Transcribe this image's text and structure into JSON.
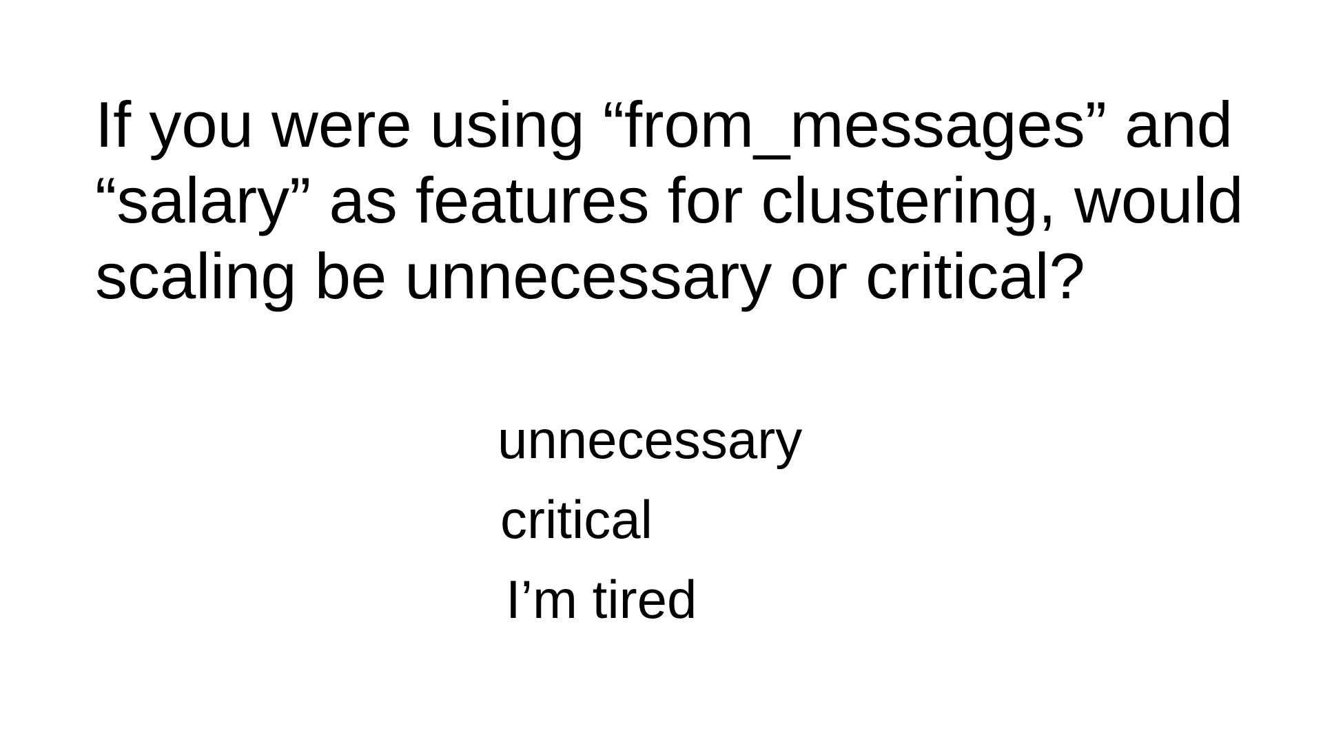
{
  "slide": {
    "question_lines": [
      "If you were using “from_messages” and",
      "“salary” as features for clustering, would",
      "scaling be unnecessary or critical?"
    ],
    "options": [
      "unnecessary",
      "critical",
      "I’m tired"
    ],
    "colors": {
      "background": "#ffffff",
      "text": "#000000"
    }
  }
}
